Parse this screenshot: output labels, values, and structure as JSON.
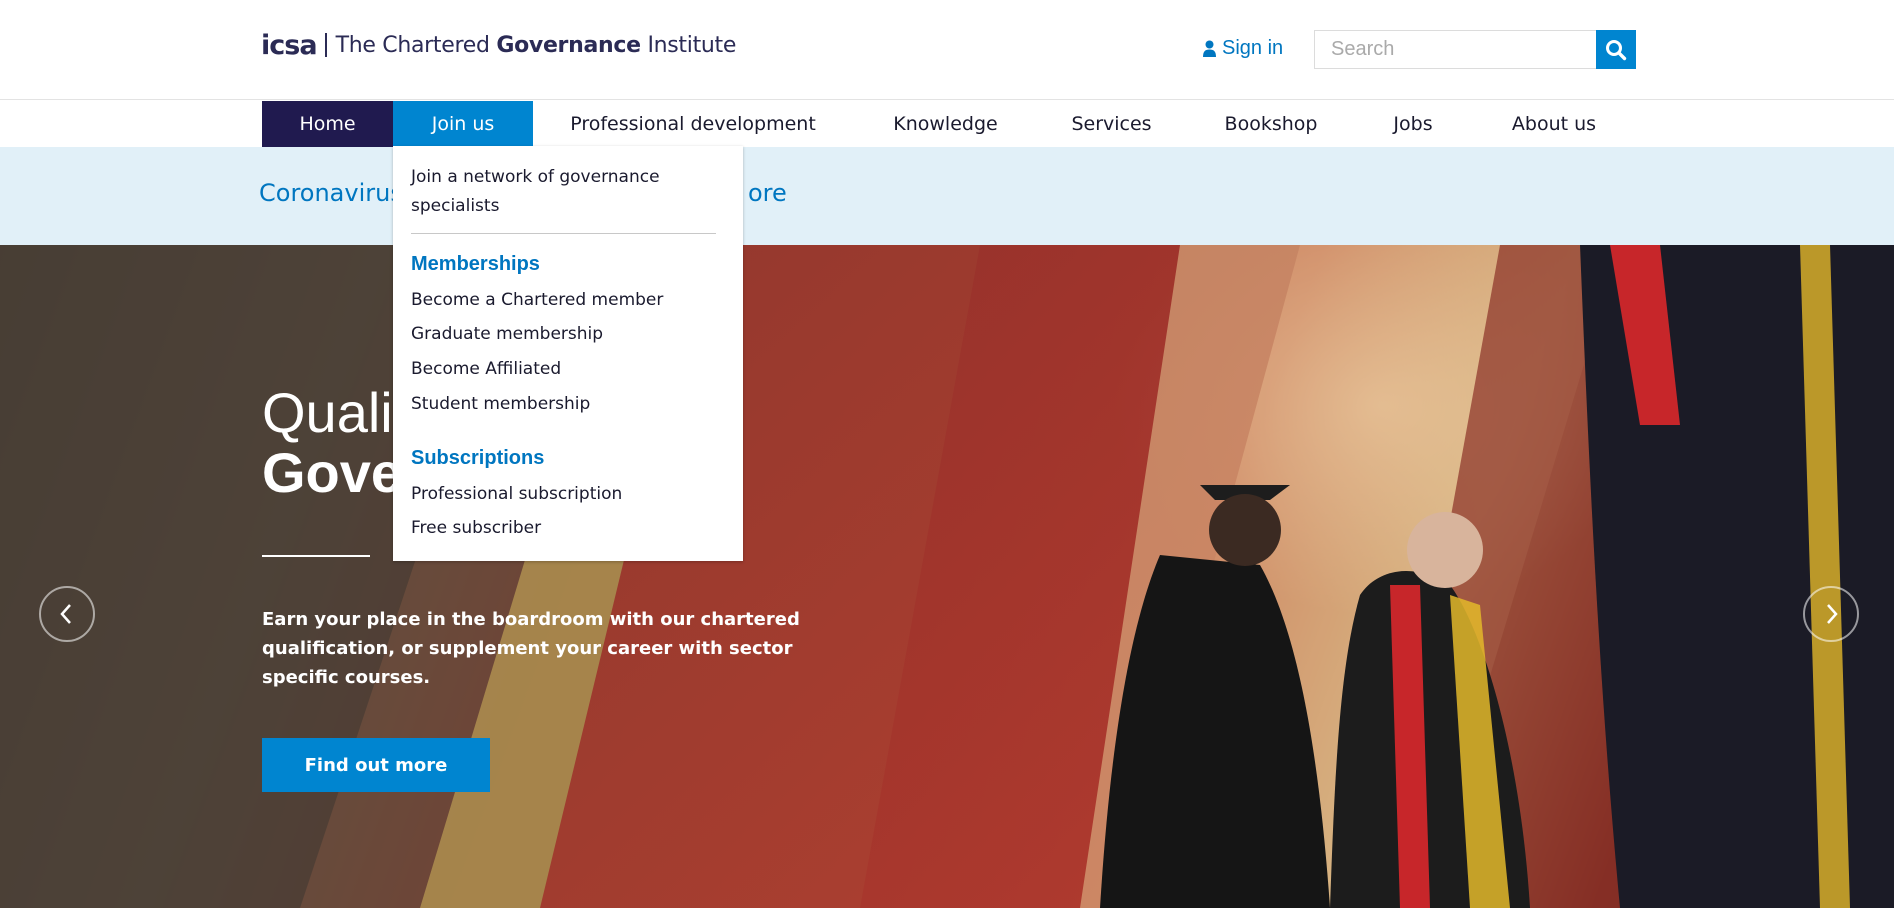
{
  "header": {
    "logo_mark": "icsa",
    "logo_text_pre": "The Chartered ",
    "logo_text_bold": "Governance",
    "logo_text_post": " Institute",
    "signin_icon": "user-icon",
    "signin_label": "Sign in",
    "search_placeholder": "Search",
    "search_icon": "search-icon"
  },
  "nav": {
    "items": [
      {
        "label": "Home",
        "state": "active"
      },
      {
        "label": "Join us",
        "state": "open"
      },
      {
        "label": "Professional development"
      },
      {
        "label": "Knowledge"
      },
      {
        "label": "Services"
      },
      {
        "label": "Bookshop"
      },
      {
        "label": "Jobs"
      },
      {
        "label": "About us"
      }
    ]
  },
  "dropdown": {
    "intro": "Join a network of governance specialists",
    "sections": [
      {
        "heading": "Memberships",
        "links": [
          "Become a Chartered member",
          "Graduate membership",
          "Become Affiliated",
          "Student membership"
        ]
      },
      {
        "heading": "Subscriptions",
        "links": [
          "Professional subscription",
          "Free subscriber"
        ]
      }
    ]
  },
  "banner": {
    "text_visible_start": "Coronavirus",
    "text_visible_end": "ore"
  },
  "hero": {
    "title_line1": "Quali",
    "title_line2": "Gove",
    "description": "Earn your place in the boardroom with our chartered qualification, or supplement your career with sector specific courses.",
    "cta_label": "Find out more",
    "prev_icon": "chevron-left-icon",
    "next_icon": "chevron-right-icon"
  },
  "colors": {
    "brand_navy": "#201a4f",
    "brand_blue": "#0085d0",
    "link_blue": "#0076c0",
    "banner_bg": "#e1f0f8"
  }
}
